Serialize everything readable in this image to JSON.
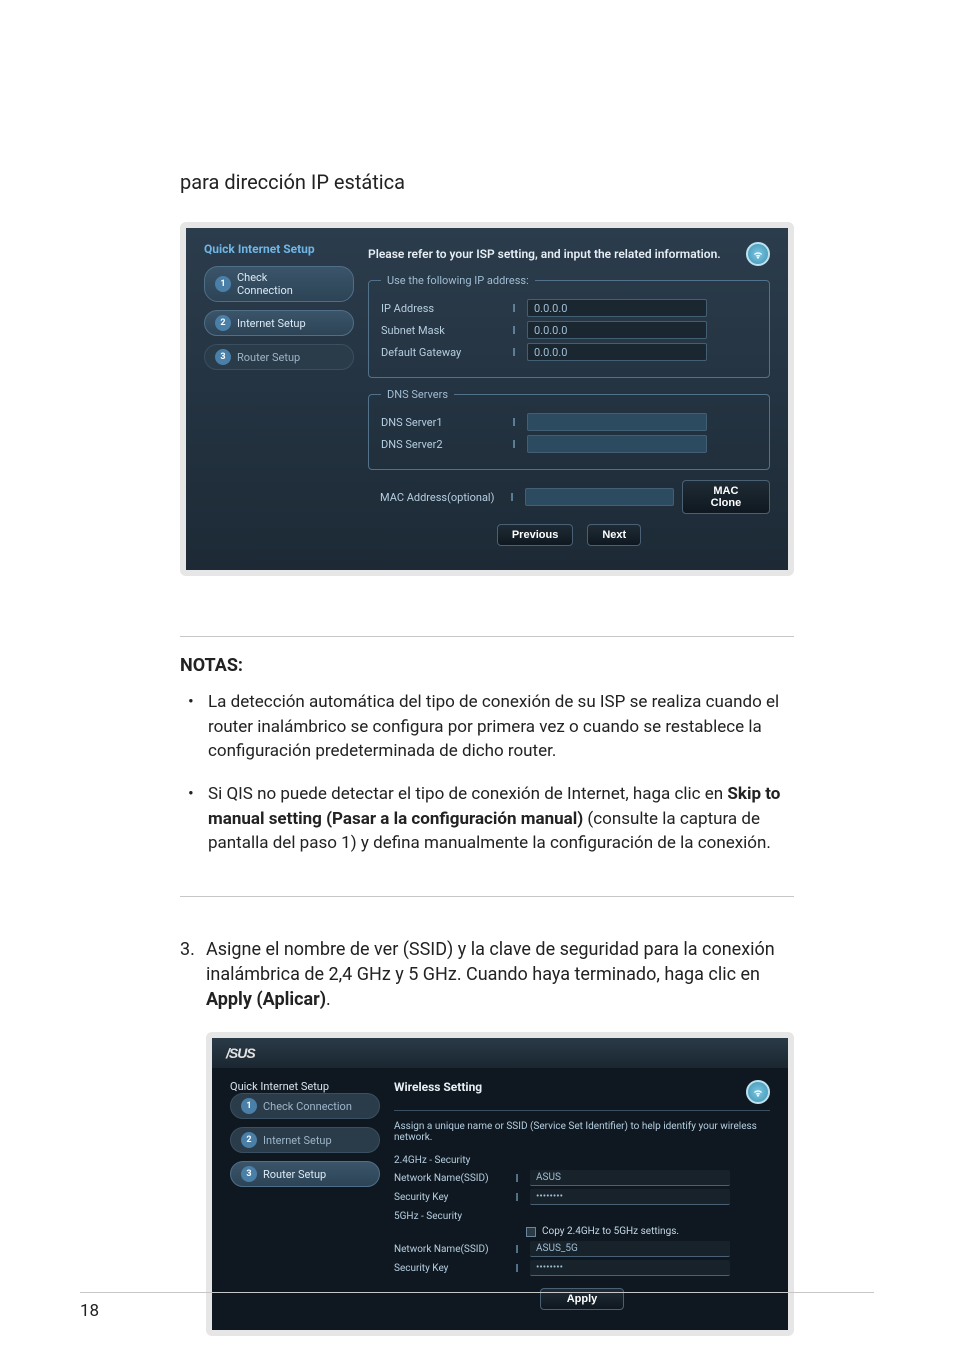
{
  "section_title": "para dirección IP estática",
  "shot1": {
    "sidebar_title": "Quick Internet Setup",
    "steps": [
      {
        "n": "1",
        "label": "Check\nConnection"
      },
      {
        "n": "2",
        "label": "Internet Setup"
      },
      {
        "n": "3",
        "label": "Router Setup"
      }
    ],
    "header": "Please refer to your ISP setting, and input the related information.",
    "legend_ip": "Use the following IP address:",
    "ip_rows": [
      {
        "label": "IP Address",
        "value": "0.0.0.0"
      },
      {
        "label": "Subnet Mask",
        "value": "0.0.0.0"
      },
      {
        "label": "Default Gateway",
        "value": "0.0.0.0"
      }
    ],
    "legend_dns": "DNS Servers",
    "dns_rows": [
      {
        "label": "DNS Server1",
        "value": ""
      },
      {
        "label": "DNS Server2",
        "value": ""
      }
    ],
    "mac_label": "MAC Address(optional)",
    "mac_value": "",
    "mac_clone": "MAC Clone",
    "prev": "Previous",
    "next": "Next"
  },
  "notes": {
    "title": "NOTAS",
    "items": [
      {
        "text": "La detección automática del tipo de conexión de su ISP se realiza cuando el router inalámbrico se configura por primera vez o cuando se restablece la configuración predeterminada de dicho router."
      },
      {
        "pre": "Si QIS no puede detectar el tipo de conexión de Internet, haga clic en ",
        "bold": "Skip to manual setting (Pasar a la configuración manual)",
        "post": " (consulte la captura de pantalla del paso 1) y defina manualmente la configuración de la conexión."
      }
    ]
  },
  "step3": {
    "num": "3.",
    "text_pre": "Asigne el nombre de ver (SSID) y la clave de seguridad para la conexión inalámbrica de 2,4 GHz y 5 GHz. Cuando haya terminado, haga clic en ",
    "text_bold": "Apply (Aplicar)",
    "text_post": "."
  },
  "shot2": {
    "logo": "/SUS",
    "sidebar_title": "Quick Internet Setup",
    "steps": [
      {
        "n": "1",
        "label": "Check Connection"
      },
      {
        "n": "2",
        "label": "Internet Setup"
      },
      {
        "n": "3",
        "label": "Router Setup"
      }
    ],
    "heading": "Wireless Setting",
    "desc": "Assign a unique name or SSID (Service Set Identifier) to help identify your wireless network.",
    "group24": "2.4GHz - Security",
    "ssid_label": "Network Name(SSID)",
    "key_label": "Security Key",
    "ssid24": "ASUS",
    "key24": "••••••••",
    "group5": "5GHz - Security",
    "copy_label": "Copy 2.4GHz to 5GHz settings.",
    "ssid5": "ASUS_5G",
    "key5": "••••••••",
    "apply": "Apply"
  },
  "page_number": "18"
}
